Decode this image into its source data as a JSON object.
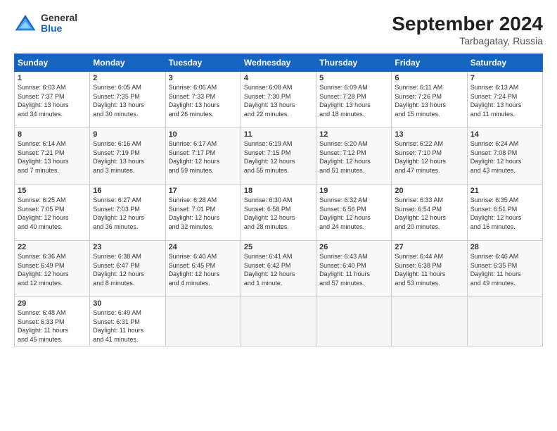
{
  "logo": {
    "general": "General",
    "blue": "Blue"
  },
  "title": "September 2024",
  "subtitle": "Tarbagatay, Russia",
  "days": [
    "Sunday",
    "Monday",
    "Tuesday",
    "Wednesday",
    "Thursday",
    "Friday",
    "Saturday"
  ],
  "weeks": [
    [
      {
        "num": "1",
        "info": "Sunrise: 6:03 AM\nSunset: 7:37 PM\nDaylight: 13 hours\nand 34 minutes."
      },
      {
        "num": "2",
        "info": "Sunrise: 6:05 AM\nSunset: 7:35 PM\nDaylight: 13 hours\nand 30 minutes."
      },
      {
        "num": "3",
        "info": "Sunrise: 6:06 AM\nSunset: 7:33 PM\nDaylight: 13 hours\nand 26 minutes."
      },
      {
        "num": "4",
        "info": "Sunrise: 6:08 AM\nSunset: 7:30 PM\nDaylight: 13 hours\nand 22 minutes."
      },
      {
        "num": "5",
        "info": "Sunrise: 6:09 AM\nSunset: 7:28 PM\nDaylight: 13 hours\nand 18 minutes."
      },
      {
        "num": "6",
        "info": "Sunrise: 6:11 AM\nSunset: 7:26 PM\nDaylight: 13 hours\nand 15 minutes."
      },
      {
        "num": "7",
        "info": "Sunrise: 6:13 AM\nSunset: 7:24 PM\nDaylight: 13 hours\nand 11 minutes."
      }
    ],
    [
      {
        "num": "8",
        "info": "Sunrise: 6:14 AM\nSunset: 7:21 PM\nDaylight: 13 hours\nand 7 minutes."
      },
      {
        "num": "9",
        "info": "Sunrise: 6:16 AM\nSunset: 7:19 PM\nDaylight: 13 hours\nand 3 minutes."
      },
      {
        "num": "10",
        "info": "Sunrise: 6:17 AM\nSunset: 7:17 PM\nDaylight: 12 hours\nand 59 minutes."
      },
      {
        "num": "11",
        "info": "Sunrise: 6:19 AM\nSunset: 7:15 PM\nDaylight: 12 hours\nand 55 minutes."
      },
      {
        "num": "12",
        "info": "Sunrise: 6:20 AM\nSunset: 7:12 PM\nDaylight: 12 hours\nand 51 minutes."
      },
      {
        "num": "13",
        "info": "Sunrise: 6:22 AM\nSunset: 7:10 PM\nDaylight: 12 hours\nand 47 minutes."
      },
      {
        "num": "14",
        "info": "Sunrise: 6:24 AM\nSunset: 7:08 PM\nDaylight: 12 hours\nand 43 minutes."
      }
    ],
    [
      {
        "num": "15",
        "info": "Sunrise: 6:25 AM\nSunset: 7:05 PM\nDaylight: 12 hours\nand 40 minutes."
      },
      {
        "num": "16",
        "info": "Sunrise: 6:27 AM\nSunset: 7:03 PM\nDaylight: 12 hours\nand 36 minutes."
      },
      {
        "num": "17",
        "info": "Sunrise: 6:28 AM\nSunset: 7:01 PM\nDaylight: 12 hours\nand 32 minutes."
      },
      {
        "num": "18",
        "info": "Sunrise: 6:30 AM\nSunset: 6:58 PM\nDaylight: 12 hours\nand 28 minutes."
      },
      {
        "num": "19",
        "info": "Sunrise: 6:32 AM\nSunset: 6:56 PM\nDaylight: 12 hours\nand 24 minutes."
      },
      {
        "num": "20",
        "info": "Sunrise: 6:33 AM\nSunset: 6:54 PM\nDaylight: 12 hours\nand 20 minutes."
      },
      {
        "num": "21",
        "info": "Sunrise: 6:35 AM\nSunset: 6:51 PM\nDaylight: 12 hours\nand 16 minutes."
      }
    ],
    [
      {
        "num": "22",
        "info": "Sunrise: 6:36 AM\nSunset: 6:49 PM\nDaylight: 12 hours\nand 12 minutes."
      },
      {
        "num": "23",
        "info": "Sunrise: 6:38 AM\nSunset: 6:47 PM\nDaylight: 12 hours\nand 8 minutes."
      },
      {
        "num": "24",
        "info": "Sunrise: 6:40 AM\nSunset: 6:45 PM\nDaylight: 12 hours\nand 4 minutes."
      },
      {
        "num": "25",
        "info": "Sunrise: 6:41 AM\nSunset: 6:42 PM\nDaylight: 12 hours\nand 1 minute."
      },
      {
        "num": "26",
        "info": "Sunrise: 6:43 AM\nSunset: 6:40 PM\nDaylight: 11 hours\nand 57 minutes."
      },
      {
        "num": "27",
        "info": "Sunrise: 6:44 AM\nSunset: 6:38 PM\nDaylight: 11 hours\nand 53 minutes."
      },
      {
        "num": "28",
        "info": "Sunrise: 6:46 AM\nSunset: 6:35 PM\nDaylight: 11 hours\nand 49 minutes."
      }
    ],
    [
      {
        "num": "29",
        "info": "Sunrise: 6:48 AM\nSunset: 6:33 PM\nDaylight: 11 hours\nand 45 minutes."
      },
      {
        "num": "30",
        "info": "Sunrise: 6:49 AM\nSunset: 6:31 PM\nDaylight: 11 hours\nand 41 minutes."
      },
      null,
      null,
      null,
      null,
      null
    ]
  ]
}
